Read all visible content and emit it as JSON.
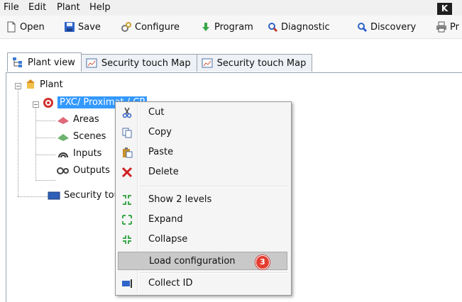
{
  "menu": {
    "items": [
      "File",
      "Edit",
      "Plant",
      "Help"
    ],
    "badge": "K"
  },
  "toolbar": {
    "open": "Open",
    "save": "Save",
    "configure": "Configure",
    "program": "Program",
    "diagnostic": "Diagnostic",
    "discovery": "Discovery",
    "print": "Pr"
  },
  "tabs": [
    {
      "label": "Plant view",
      "icon": "plant-view-icon"
    },
    {
      "label": "Security touch Map",
      "icon": "map-icon"
    },
    {
      "label": "Security touch Map",
      "icon": "map-icon"
    }
  ],
  "tree": {
    "root": "Plant",
    "device": "PXC/ Proximat / CP",
    "children": [
      "Areas",
      "Scenes",
      "Inputs",
      "Outputs"
    ],
    "security": "Security touch Map"
  },
  "context_menu": {
    "items": [
      {
        "label": "Cut",
        "icon": "scissors-icon"
      },
      {
        "label": "Copy",
        "icon": "copy-icon"
      },
      {
        "label": "Paste",
        "icon": "paste-icon"
      },
      {
        "label": "Delete",
        "icon": "delete-x-icon"
      },
      {
        "label": "Show 2 levels",
        "icon": "show-levels-icon"
      },
      {
        "label": "Expand",
        "icon": "expand-icon"
      },
      {
        "label": "Collapse",
        "icon": "collapse-icon"
      },
      {
        "label": "Load configuration",
        "icon": "load-config-icon",
        "badge": "3"
      },
      {
        "label": "Collect ID",
        "icon": "collect-id-icon"
      }
    ]
  },
  "colors": {
    "selection": "#3399ff",
    "highlight": "#c9c9c9",
    "badge": "#e43d2f"
  }
}
